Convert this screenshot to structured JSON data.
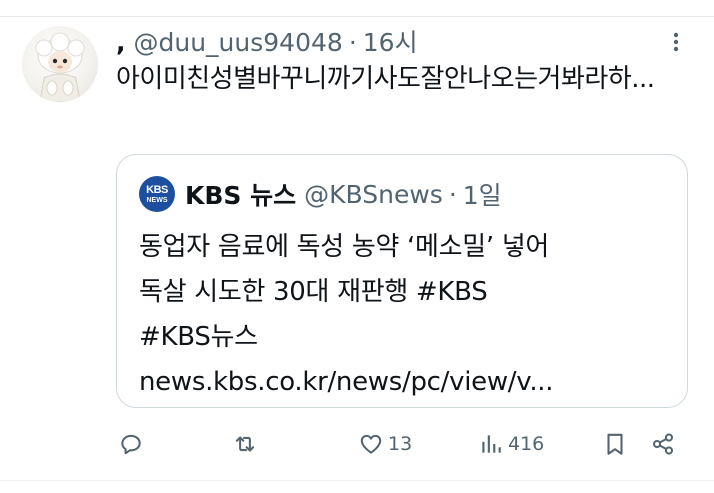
{
  "tweet": {
    "display_name": ",",
    "handle": "@duu_uus94048",
    "separator": "·",
    "timestamp": "16시",
    "text": "아이미친성별바꾸니까기사도잘안나오는거봐라하...",
    "avatar": "avatar-plush-doll-icon",
    "more_icon": "more-vertical-icon"
  },
  "quote": {
    "logo_text_top": "KBS",
    "logo_text_bottom": "NEWS",
    "logo_color": "#1c4fa0",
    "name": "KBS 뉴스",
    "handle": "@KBSnews",
    "separator": "·",
    "timestamp": "1일",
    "lines": [
      "동업자 음료에 독성 농약 ‘메소밀’ 넣어",
      "독살 시도한 30대 재판행 #KBS",
      "#KBS뉴스",
      "news.kbs.co.kr/news/pc/view/v..."
    ]
  },
  "actions": {
    "reply_icon": "reply-icon",
    "retweet_icon": "retweet-icon",
    "like_icon": "heart-icon",
    "like_count": "13",
    "views_icon": "views-icon",
    "views_count": "416",
    "bookmark_icon": "bookmark-icon",
    "share_icon": "share-icon"
  },
  "colors": {
    "text_primary": "#0f1419",
    "text_secondary": "#536471",
    "border": "#cfd9de"
  }
}
